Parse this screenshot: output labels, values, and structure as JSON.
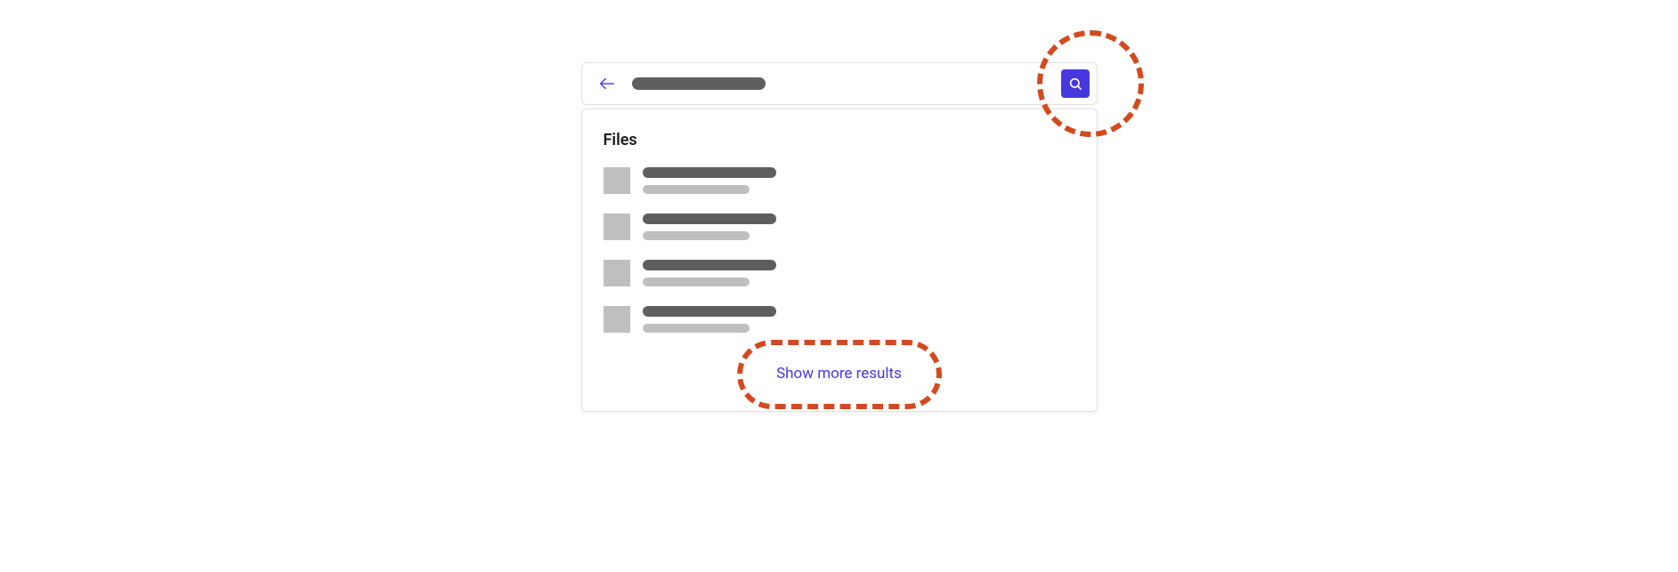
{
  "search": {
    "section_title": "Files",
    "show_more_label": "Show more results"
  },
  "annotations": {
    "highlight_color": "#d24a1e",
    "accent_color": "#4737de"
  },
  "results": {
    "count": 4
  }
}
